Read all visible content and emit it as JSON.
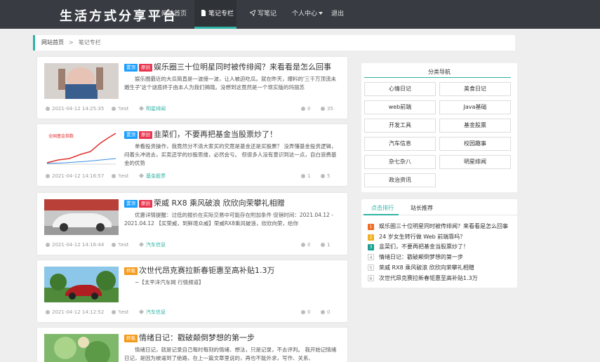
{
  "header": {
    "logo": "生活方式分享平台",
    "nav": [
      {
        "label": "网站首页",
        "icon": "none"
      },
      {
        "label": "笔记专栏",
        "icon": "document-icon"
      },
      {
        "label": "写笔记",
        "icon": "send-icon"
      },
      {
        "label": "个人中心",
        "icon": "chevron-down-icon"
      },
      {
        "label": "退出",
        "icon": "none"
      }
    ]
  },
  "breadcrumb": {
    "home": "网站首页",
    "sep": ">",
    "current": "笔记专栏"
  },
  "posts": [
    {
      "badges": [
        "置顶",
        "原创"
      ],
      "title": "娱乐圈三十位明星同时被传绯闻？来看看是怎么回事",
      "excerpt": "娱乐圈最近的大瓜简直是一波接一波，让人被迫吃瓜。就在昨天，爆料的'三千万顶流未婚生子'这个谜底终于由本人为我们揭晓。没想到这竟然是一个现实版的玛丽苏",
      "time": "2021-04-12 14:25:35",
      "author": "'test",
      "category": "明星绯闻",
      "comments": "0",
      "views": "35"
    },
    {
      "badges": [
        "置顶",
        "原创"
      ],
      "title": "韭菜们，不要再把基金当股票炒了！",
      "excerpt": "单看投资操作，我竟然分不清大家买的究竟是基金还是买股票？ 没弄懂基金投资逻辑，闷着头冲进去，买卖还学的炒股思维，必然会亏。 但很多人没有意识到这一点，自白浪费基金的优势",
      "time": "2021-04-12 14:16:57",
      "author": "'test",
      "category": "基金股票",
      "comments": "1",
      "views": "5"
    },
    {
      "badges": [
        "置顶",
        "原创"
      ],
      "title": "荣威 RX8 乘风破浪 欣欣向荣攀礼相赠",
      "excerpt": "优惠详情提醒：过低的报价在实际交易中可能存在附加条件 促销时间：2021.04.12 - 2021.04.12 【买荣威，到鲜境众威】荣威RX8乘风破浪，欣欣向荣，给你",
      "time": "2021-04-12 14:16:44",
      "author": "'test",
      "category": "汽车信息",
      "comments": "0",
      "views": "1"
    },
    {
      "badges": [
        "转载"
      ],
      "title": "次世代昂克赛拉新春钜惠至高补贴1.3万",
      "excerpt": "~【太平洋汽车网 行情频道】",
      "time": "2021-04-12 14:12:52",
      "author": "'test",
      "category": "汽车信息",
      "comments": "0",
      "views": "0"
    },
    {
      "badges": [
        "转载"
      ],
      "title": "情绪日记：戳破颠倒梦想的第一步",
      "excerpt": "情绪日记，就是记录自己每时每刻的情绪、想法，只是记录，不去评判。 我开始记情绪日记，是因为被逼到了绝路，在上一篇文章里说的，再也不能外求，写作、关系、",
      "time": "",
      "author": "",
      "category": "",
      "comments": "",
      "views": ""
    }
  ],
  "categories": {
    "title": "分类导航",
    "items": [
      "心情日记",
      "美食日记",
      "web前端",
      "Java基础",
      "开发工具",
      "基金股票",
      "汽车信息",
      "校园趣事",
      "杂七杂八",
      "明星绯闻",
      "政治资讯"
    ]
  },
  "ranking": {
    "tabs": [
      "点击排行",
      "站长推荐"
    ],
    "items": [
      "娱乐圈三十位明星同时被传绯闻？来看看是怎么回事",
      "24 岁女生转行做 Web 前端靠吗？",
      "韭菜们，不要再把基金当股票炒了！",
      "情绪日记：戳破颠倒梦想的第一步",
      "荣威 RX8 乘风破浪 欣欣向荣攀礼相赠",
      "次世代昂克赛拉新春钜惠至高补贴1.3万"
    ]
  },
  "colors": {
    "accent": "#2fb3a5",
    "nav_bg": "#383c42",
    "badge_top": "#1e9fff",
    "badge_orig": "#e9354f",
    "badge_repost": "#f39b1c"
  }
}
